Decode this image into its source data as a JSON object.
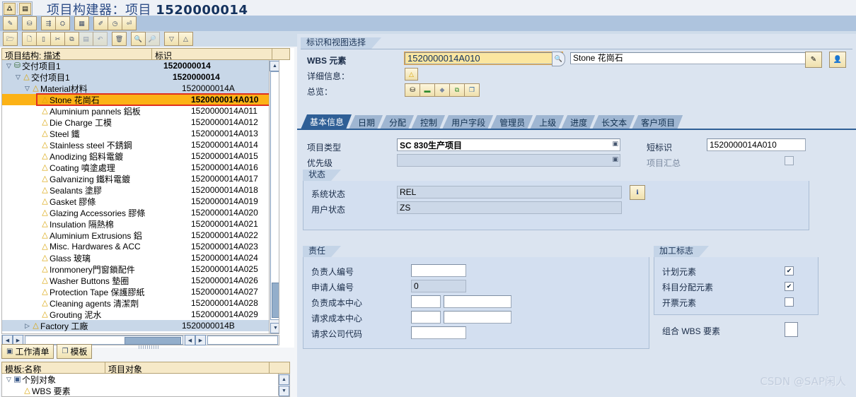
{
  "window": {
    "title_prefix": "项目构建器：项目",
    "title_id": "1520000014",
    "titlebar_icons": [
      "sap-logo-icon",
      "window-menu-icon"
    ]
  },
  "toolbar_row1": [
    {
      "name": "display-change-icon",
      "glyph": "✎"
    },
    {
      "name": "project-icon",
      "glyph": "⛁"
    },
    {
      "name": "hierarchy-icon",
      "glyph": "⇥"
    },
    {
      "name": "network-icon",
      "glyph": "⛭"
    },
    {
      "name": "table-icon",
      "glyph": "▦"
    },
    {
      "name": "edit-doc-icon",
      "glyph": "✐"
    },
    {
      "name": "clock-icon",
      "glyph": "◷"
    },
    {
      "name": "exit-icon",
      "glyph": "⏻"
    }
  ],
  "toolbar_row2": [
    {
      "name": "open-icon",
      "glyph": "📂"
    },
    {
      "name": "new-icon",
      "glyph": "🗋"
    },
    {
      "name": "copy-item-icon",
      "glyph": "▯"
    },
    {
      "name": "cut-icon",
      "glyph": "✂"
    },
    {
      "name": "copy-icon",
      "glyph": "⧉"
    },
    {
      "name": "paste-icon",
      "glyph": "▤"
    },
    {
      "name": "undo-icon",
      "glyph": "↶"
    },
    {
      "name": "delete-icon",
      "glyph": "🗑"
    },
    {
      "name": "find-icon",
      "glyph": "🔍"
    },
    {
      "name": "find-next-icon",
      "glyph": "🔎"
    },
    {
      "name": "filter-icon",
      "glyph": "▽"
    },
    {
      "name": "sort-icon",
      "glyph": "△"
    }
  ],
  "tree": {
    "columns": [
      "项目结构: 描述",
      "标识"
    ],
    "rows": [
      {
        "level": 0,
        "twisty": "▽",
        "icon": "project-def-icon",
        "glyph": "⛁",
        "label": "交付项目1",
        "id": "1520000014",
        "style": "hdr"
      },
      {
        "level": 1,
        "twisty": "▽",
        "icon": "wbs-icon",
        "glyph": "△",
        "label": "交付项目1",
        "id": "1520000014",
        "style": "hdr"
      },
      {
        "level": 2,
        "twisty": "▽",
        "icon": "wbs-icon",
        "glyph": "△",
        "label": "Material材料",
        "id": "1520000014A",
        "style": "hdr"
      },
      {
        "level": 3,
        "twisty": "",
        "icon": "wbs-icon",
        "glyph": "△",
        "label": "Stone 花崗石",
        "id": "1520000014A010",
        "style": "sel"
      },
      {
        "level": 3,
        "twisty": "",
        "icon": "wbs-icon",
        "glyph": "△",
        "label": "Aluminium pannels 鋁板",
        "id": "1520000014A011",
        "style": ""
      },
      {
        "level": 3,
        "twisty": "",
        "icon": "wbs-icon",
        "glyph": "△",
        "label": "Die Charge 工模",
        "id": "1520000014A012",
        "style": ""
      },
      {
        "level": 3,
        "twisty": "",
        "icon": "wbs-icon",
        "glyph": "△",
        "label": "Steel 鐵",
        "id": "1520000014A013",
        "style": ""
      },
      {
        "level": 3,
        "twisty": "",
        "icon": "wbs-icon",
        "glyph": "△",
        "label": "Stainless steel 不銹鋼",
        "id": "1520000014A014",
        "style": ""
      },
      {
        "level": 3,
        "twisty": "",
        "icon": "wbs-icon",
        "glyph": "△",
        "label": "Anodizing 鋁料電鍍",
        "id": "1520000014A015",
        "style": ""
      },
      {
        "level": 3,
        "twisty": "",
        "icon": "wbs-icon",
        "glyph": "△",
        "label": "Coating 噴塗處理",
        "id": "1520000014A016",
        "style": ""
      },
      {
        "level": 3,
        "twisty": "",
        "icon": "wbs-icon",
        "glyph": "△",
        "label": "Galvanizing 鐵料電鍍",
        "id": "1520000014A017",
        "style": ""
      },
      {
        "level": 3,
        "twisty": "",
        "icon": "wbs-icon",
        "glyph": "△",
        "label": "Sealants 塗膠",
        "id": "1520000014A018",
        "style": ""
      },
      {
        "level": 3,
        "twisty": "",
        "icon": "wbs-icon",
        "glyph": "△",
        "label": "Gasket 膠條",
        "id": "1520000014A019",
        "style": ""
      },
      {
        "level": 3,
        "twisty": "",
        "icon": "wbs-icon",
        "glyph": "△",
        "label": "Glazing Accessories 膠條",
        "id": "1520000014A020",
        "style": ""
      },
      {
        "level": 3,
        "twisty": "",
        "icon": "wbs-icon",
        "glyph": "△",
        "label": "Insulation 隔熱棉",
        "id": "1520000014A021",
        "style": ""
      },
      {
        "level": 3,
        "twisty": "",
        "icon": "wbs-icon",
        "glyph": "△",
        "label": "Aluminium Extrusions 鋁",
        "id": "1520000014A022",
        "style": ""
      },
      {
        "level": 3,
        "twisty": "",
        "icon": "wbs-icon",
        "glyph": "△",
        "label": "Misc. Hardwares & ACC ",
        "id": "1520000014A023",
        "style": ""
      },
      {
        "level": 3,
        "twisty": "",
        "icon": "wbs-icon",
        "glyph": "△",
        "label": "Glass 玻璃",
        "id": "1520000014A024",
        "style": ""
      },
      {
        "level": 3,
        "twisty": "",
        "icon": "wbs-icon",
        "glyph": "△",
        "label": "Ironmonery門窗鎖配件",
        "id": "1520000014A025",
        "style": ""
      },
      {
        "level": 3,
        "twisty": "",
        "icon": "wbs-icon",
        "glyph": "△",
        "label": "Washer Buttons 墊圈",
        "id": "1520000014A026",
        "style": ""
      },
      {
        "level": 3,
        "twisty": "",
        "icon": "wbs-icon",
        "glyph": "△",
        "label": "Protection Tape 保護膠紙",
        "id": "1520000014A027",
        "style": ""
      },
      {
        "level": 3,
        "twisty": "",
        "icon": "wbs-icon",
        "glyph": "△",
        "label": "Cleaning agents 清潔劑",
        "id": "1520000014A028",
        "style": ""
      },
      {
        "level": 3,
        "twisty": "",
        "icon": "wbs-icon",
        "glyph": "△",
        "label": "Grouting 泥水",
        "id": "1520000014A029",
        "style": ""
      },
      {
        "level": 2,
        "twisty": "▷",
        "icon": "wbs-icon",
        "glyph": "△",
        "label": "Factory 工廠",
        "id": "1520000014B",
        "style": "hdr"
      }
    ]
  },
  "left_buttons": [
    {
      "name": "worklist-button",
      "label": "工作清单",
      "glyph": "▣"
    },
    {
      "name": "template-button",
      "label": "模板",
      "glyph": "❐"
    }
  ],
  "template_panel": {
    "columns": [
      "模板:名称",
      "项目对象"
    ],
    "rows": [
      {
        "twisty": "▽",
        "glyph": "▣",
        "label": "个别对象",
        "level": 0
      },
      {
        "twisty": "",
        "glyph": "△",
        "label": "WBS 要素",
        "level": 1
      }
    ]
  },
  "selection": {
    "group_title": "标识和视图选择",
    "wbs_label": "WBS 元素",
    "wbs_value": "1520000014A010",
    "wbs_desc": "Stone 花崗石",
    "detail_label": "详细信息：",
    "detail_icon": "wbs-triangle-icon",
    "overview_label": "总览：",
    "overview_icons": [
      {
        "name": "hierarchy-overview-icon",
        "glyph": "⛁"
      },
      {
        "name": "bar-overview-icon",
        "glyph": "▬"
      },
      {
        "name": "diamond-overview-icon",
        "glyph": "◆"
      },
      {
        "name": "copy-overview-icon",
        "glyph": "⧉"
      },
      {
        "name": "pages-overview-icon",
        "glyph": "❐"
      }
    ],
    "edit_button_icon": "edit-pencil-icon",
    "person_button_icon": "person-icon",
    "search_icon": "search-icon"
  },
  "tabs": [
    {
      "name": "tab-basic-info",
      "label": "基本信息",
      "active": true
    },
    {
      "name": "tab-dates",
      "label": "日期",
      "active": false
    },
    {
      "name": "tab-assignment",
      "label": "分配",
      "active": false
    },
    {
      "name": "tab-control",
      "label": "控制",
      "active": false
    },
    {
      "name": "tab-user-fields",
      "label": "用户字段",
      "active": false
    },
    {
      "name": "tab-administration",
      "label": "管理员",
      "active": false
    },
    {
      "name": "tab-superior",
      "label": "上级",
      "active": false
    },
    {
      "name": "tab-progress",
      "label": "进度",
      "active": false
    },
    {
      "name": "tab-long-text",
      "label": "长文本",
      "active": false
    },
    {
      "name": "tab-customer-project",
      "label": "客户项目",
      "active": false
    }
  ],
  "basic_info": {
    "project_type_label": "项目类型",
    "project_type_value": "SC 830生产项目",
    "priority_label": "优先级",
    "priority_value": "",
    "short_id_label": "短标识",
    "short_id_value": "1520000014A010",
    "rollup_label": "项目汇总",
    "rollup_checked": false,
    "status": {
      "title": "状态",
      "system_status_label": "系统状态",
      "system_status_value": "REL",
      "user_status_label": "用户状态",
      "user_status_value": "ZS",
      "info_button_icon": "info-icon"
    },
    "responsibility": {
      "title": "责任",
      "fields": [
        {
          "name": "person-responsible-number",
          "label": "负责人编号",
          "value": "",
          "readonly": false,
          "extra": false
        },
        {
          "name": "applicant-number",
          "label": "申请人编号",
          "value": "0",
          "readonly": true,
          "extra": false
        },
        {
          "name": "responsible-cost-center",
          "label": "负责成本中心",
          "value": "",
          "readonly": false,
          "extra": true
        },
        {
          "name": "requesting-cost-center",
          "label": "请求成本中心",
          "value": "",
          "readonly": false,
          "extra": true
        },
        {
          "name": "requesting-company-code",
          "label": "请求公司代码",
          "value": "",
          "readonly": false,
          "extra": false
        }
      ]
    },
    "processing_flags": {
      "title": "加工标志",
      "items": [
        {
          "name": "planning-element",
          "label": "计划元素",
          "checked": true
        },
        {
          "name": "account-assignment-element",
          "label": "科目分配元素",
          "checked": true
        },
        {
          "name": "billing-element",
          "label": "开票元素",
          "checked": false
        }
      ],
      "grouping_label": "组合 WBS 要素",
      "grouping_checked": false
    }
  },
  "watermark": "CSDN @SAP闲人"
}
